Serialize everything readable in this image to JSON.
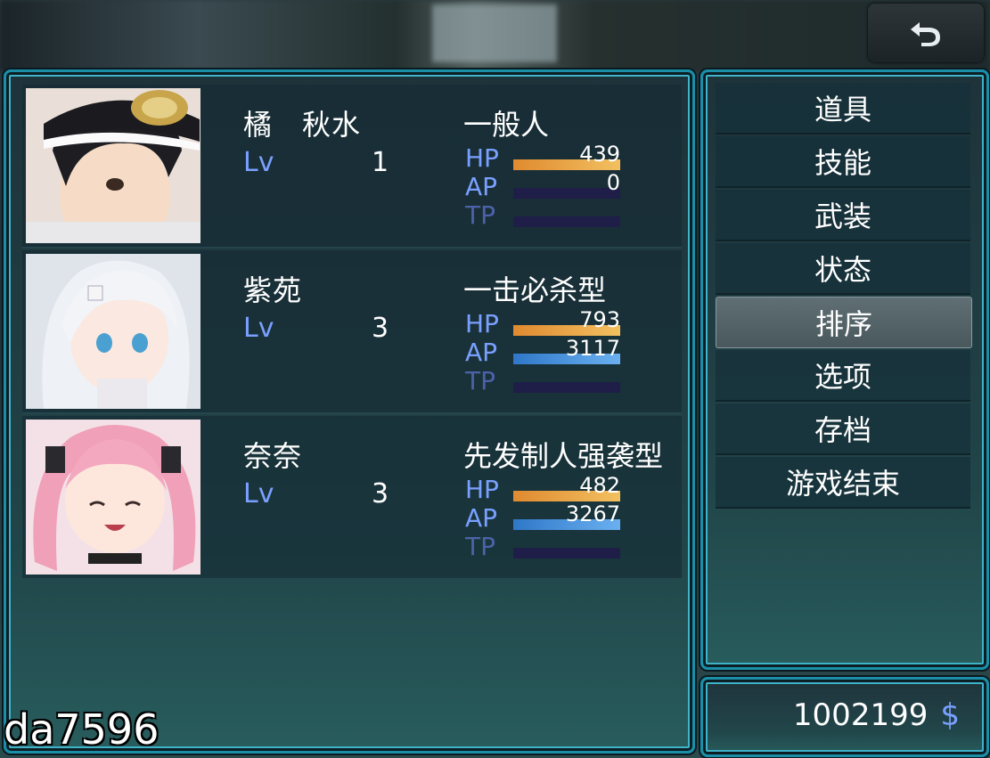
{
  "back_button": {
    "icon": "return-arrow-icon"
  },
  "party": [
    {
      "name": "橘　秋水",
      "lv_label": "Lv",
      "level": "1",
      "class": "一般人",
      "hp": {
        "label": "HP",
        "value": "439",
        "fill": 1.0
      },
      "ap": {
        "label": "AP",
        "value": "0",
        "fill": 0.0
      },
      "tp": {
        "label": "TP",
        "fill": 0.0
      }
    },
    {
      "name": "紫苑",
      "lv_label": "Lv",
      "level": "3",
      "class": "一击必杀型",
      "hp": {
        "label": "HP",
        "value": "793",
        "fill": 1.0
      },
      "ap": {
        "label": "AP",
        "value": "3117",
        "fill": 1.0
      },
      "tp": {
        "label": "TP",
        "fill": 0.0
      }
    },
    {
      "name": "奈奈",
      "lv_label": "Lv",
      "level": "3",
      "class": "先发制人强袭型",
      "hp": {
        "label": "HP",
        "value": "482",
        "fill": 1.0
      },
      "ap": {
        "label": "AP",
        "value": "3267",
        "fill": 1.0
      },
      "tp": {
        "label": "TP",
        "fill": 0.0
      }
    }
  ],
  "menu": {
    "items": [
      "道具",
      "技能",
      "武装",
      "状态",
      "排序",
      "选项",
      "存档",
      "游戏结束"
    ],
    "selected_index": 4
  },
  "gold": {
    "amount": "1002199",
    "currency": "$"
  },
  "watermark": "da7596",
  "colors": {
    "frame": "#1b8fa8",
    "label_blue": "#7aa0ff",
    "hp_bar": "#e08a30",
    "ap_bar": "#2f78c8",
    "tp_bar": "#1e1e48"
  }
}
